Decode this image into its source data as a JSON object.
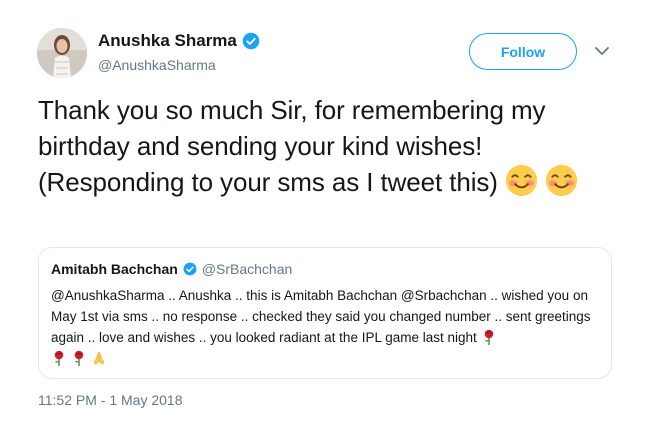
{
  "author": {
    "display_name": "Anushka Sharma",
    "handle": "@AnushkaSharma",
    "verified": true
  },
  "actions": {
    "follow_label": "Follow",
    "more_icon": "chevron-down-icon"
  },
  "tweet": {
    "text": "Thank you so much Sir, for remembering my birthday and sending your kind wishes! (Responding to your sms as I tweet this)",
    "emojis": [
      "smiling-face-icon",
      "smiling-face-icon"
    ]
  },
  "quoted_tweet": {
    "display_name": "Amitabh Bachchan",
    "handle": "@SrBachchan",
    "verified": true,
    "text": "@AnushkaSharma .. Anushka .. this is Amitabh Bachchan @Srbachchan .. wished you on May 1st via sms .. no response .. checked they said you changed number .. sent greetings again .. love and wishes .. you looked radiant at the IPL game last night",
    "emojis": [
      "rose-icon",
      "rose-icon",
      "rose-icon",
      "folded-hands-icon"
    ]
  },
  "timestamp": "11:52 PM - 1 May 2018",
  "colors": {
    "accent": "#1da1f2",
    "text": "#14171a",
    "secondary": "#657786",
    "border": "#e1e8ed"
  }
}
